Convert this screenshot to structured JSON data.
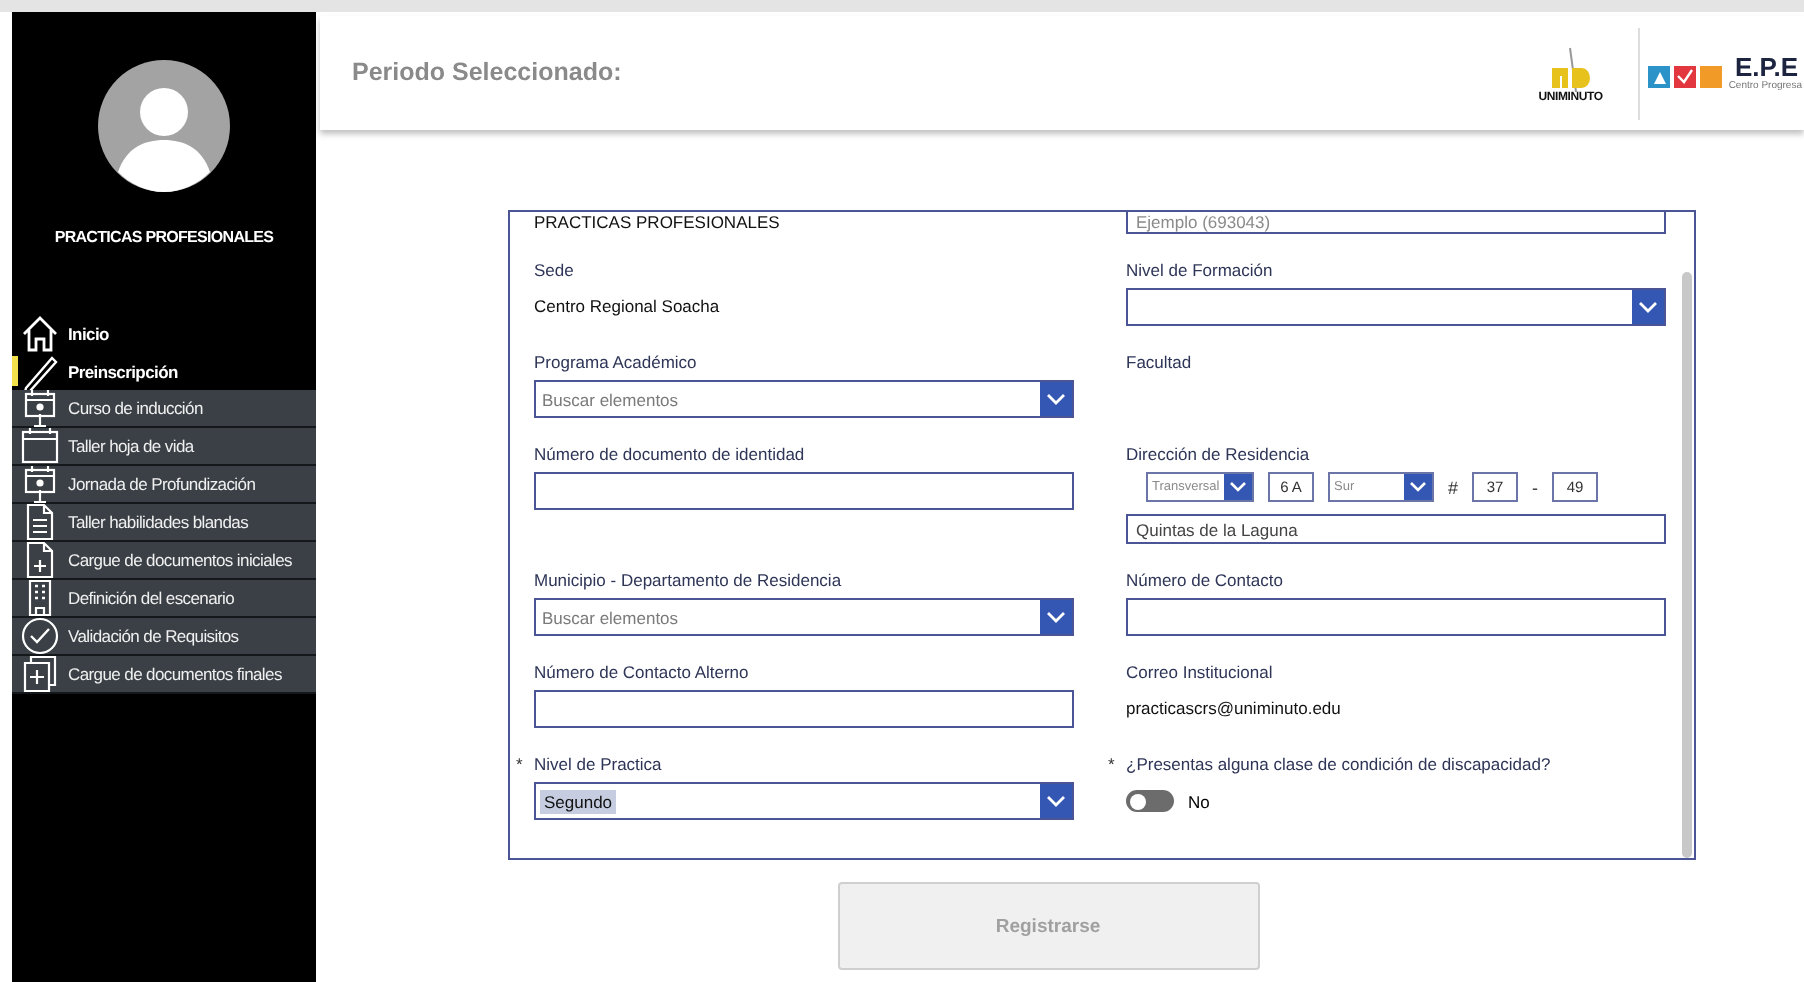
{
  "sidebar": {
    "profile_title": "PRACTICAS PROFESIONALES",
    "items": [
      {
        "label": "Inicio",
        "selected": false,
        "disabled": false
      },
      {
        "label": "Preinscripción",
        "selected": true,
        "disabled": false
      },
      {
        "label": "Curso de inducción",
        "selected": false,
        "disabled": true
      },
      {
        "label": "Taller hoja de vida",
        "selected": false,
        "disabled": true
      },
      {
        "label": "Jornada de Profundización",
        "selected": false,
        "disabled": true
      },
      {
        "label": "Taller habilidades blandas",
        "selected": false,
        "disabled": true
      },
      {
        "label": "Cargue de documentos iniciales",
        "selected": false,
        "disabled": true
      },
      {
        "label": "Definición del escenario",
        "selected": false,
        "disabled": true
      },
      {
        "label": "Validación de Requisitos",
        "selected": false,
        "disabled": true
      },
      {
        "label": "Cargue de documentos finales",
        "selected": false,
        "disabled": true
      }
    ]
  },
  "header": {
    "title": "Periodo Seleccionado:",
    "logos": [
      {
        "kind": "uniminuto",
        "text": "UNIMINUTO"
      },
      {
        "kind": "epe",
        "text": "E.P.E",
        "subtitle": "Centro Progresa"
      }
    ]
  },
  "form": {
    "rows": [
      [
        {
          "kind": "static",
          "value": "PRACTICAS PROFESIONALES"
        },
        {
          "kind": "input",
          "placeholder": "Ejemplo (693043)"
        }
      ],
      [
        {
          "kind": "static",
          "label": "Sede",
          "value": "Centro Regional Soacha"
        },
        {
          "kind": "dropdown",
          "label": "Nivel de Formación"
        }
      ],
      [
        {
          "kind": "dropdown",
          "label": "Programa Académico",
          "placeholder": "Buscar elementos"
        },
        {
          "kind": "static",
          "label": "Facultad"
        }
      ],
      [
        {
          "kind": "input",
          "label": "Número de documento de identidad"
        },
        {
          "kind": "address",
          "label": "Dirección de Residencia",
          "parts": [
            {
              "kind": "select",
              "value": "Transversal"
            },
            {
              "kind": "input",
              "value": "6 A"
            },
            {
              "kind": "select",
              "value": "Sur"
            },
            {
              "kind": "symbol",
              "text": "#"
            },
            {
              "kind": "input",
              "value": "37"
            },
            {
              "kind": "symbol",
              "text": "-"
            },
            {
              "kind": "input",
              "value": "49"
            }
          ],
          "detail": "Quintas de la Laguna"
        }
      ],
      [
        {
          "kind": "dropdown",
          "label": "Municipio - Departamento de Residencia",
          "placeholder": "Buscar elementos"
        },
        {
          "kind": "input",
          "label": "Número de Contacto"
        }
      ],
      [
        {
          "kind": "input",
          "label": "Número de Contacto Alterno"
        },
        {
          "kind": "static",
          "label": "Correo Institucional",
          "value": "practicascrs@uniminuto.edu"
        }
      ],
      [
        {
          "kind": "dropdown",
          "label": "Nivel de Practica",
          "value": "Segundo",
          "highlighted": true,
          "required_mark": "*"
        },
        {
          "kind": "toggle",
          "label": "¿Presentas alguna clase de condición de discapacidad?",
          "on": false,
          "state_text": "No",
          "required_mark": "*"
        }
      ]
    ]
  },
  "submit": {
    "label": "Registrarse",
    "disabled": true
  }
}
